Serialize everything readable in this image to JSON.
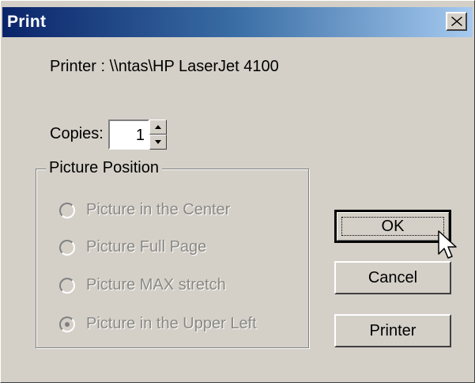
{
  "window": {
    "title": "Print"
  },
  "printer": {
    "text": "Printer : \\\\ntas\\HP LaserJet 4100"
  },
  "copies": {
    "label": "Copies:",
    "value": "1"
  },
  "picture_position": {
    "title": "Picture Position",
    "options": [
      {
        "label": "Picture in the Center",
        "selected": false
      },
      {
        "label": "Picture Full Page",
        "selected": false
      },
      {
        "label": "Picture MAX stretch",
        "selected": false
      },
      {
        "label": "Picture in the Upper Left",
        "selected": true
      }
    ]
  },
  "buttons": {
    "ok": "OK",
    "cancel": "Cancel",
    "printer": "Printer"
  },
  "colors": {
    "title_start": "#0a246a",
    "title_end": "#a6caf0",
    "face": "#d4d0c8"
  }
}
